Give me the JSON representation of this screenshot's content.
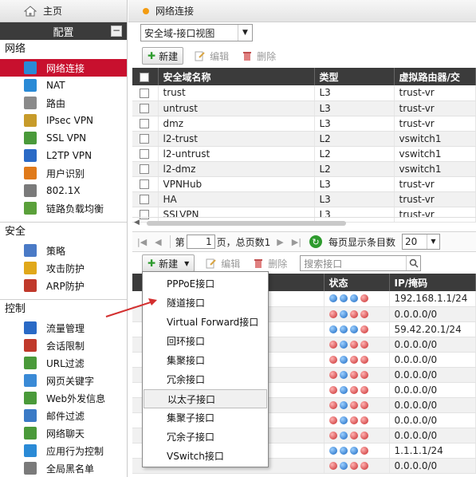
{
  "sidebar": {
    "home": "主页",
    "config": "配置",
    "collapse": "−",
    "groups": [
      {
        "title": "网络",
        "items": [
          {
            "label": "网络连接",
            "active": true,
            "icon": "globe-icon",
            "color": "#2a8ad6"
          },
          {
            "label": "NAT",
            "icon": "globe-icon",
            "color": "#2a8ad6"
          },
          {
            "label": "路由",
            "icon": "router-icon",
            "color": "#8a8a8a"
          },
          {
            "label": "IPsec VPN",
            "icon": "vpn-icon",
            "color": "#c79b2a"
          },
          {
            "label": "SSL VPN",
            "icon": "vpn-icon",
            "color": "#4a9a3a"
          },
          {
            "label": "L2TP VPN",
            "icon": "vpn-icon",
            "color": "#2a6ac6"
          },
          {
            "label": "用户识别",
            "icon": "user-icon",
            "color": "#e07a1a"
          },
          {
            "label": "802.1X",
            "icon": "users-icon",
            "color": "#7a7a7a"
          },
          {
            "label": "链路负载均衡",
            "icon": "balance-icon",
            "color": "#5aa03a"
          }
        ]
      },
      {
        "title": "安全",
        "items": [
          {
            "label": "策略",
            "icon": "policy-icon",
            "color": "#4a7ac6"
          },
          {
            "label": "攻击防护",
            "icon": "shield-icon",
            "color": "#e0a81a"
          },
          {
            "label": "ARP防护",
            "icon": "arp-icon",
            "color": "#c0392b"
          }
        ]
      },
      {
        "title": "控制",
        "items": [
          {
            "label": "流量管理",
            "icon": "traffic-icon",
            "color": "#2a6ac6"
          },
          {
            "label": "会话限制",
            "icon": "session-icon",
            "color": "#c0392b"
          },
          {
            "label": "URL过滤",
            "icon": "url-filter-icon",
            "color": "#4a9a3a"
          },
          {
            "label": "网页关键字",
            "icon": "keyword-icon",
            "color": "#3a8ad6"
          },
          {
            "label": "Web外发信息",
            "icon": "web-out-icon",
            "color": "#4a9a3a"
          },
          {
            "label": "邮件过滤",
            "icon": "mail-filter-icon",
            "color": "#3a7ac6"
          },
          {
            "label": "网络聊天",
            "icon": "chat-icon",
            "color": "#4a9a3a"
          },
          {
            "label": "应用行为控制",
            "icon": "app-control-icon",
            "color": "#2a8ad6"
          },
          {
            "label": "全局黑名单",
            "icon": "blacklist-icon",
            "color": "#7a7a7a"
          }
        ]
      }
    ]
  },
  "panel": {
    "title": "网络连接",
    "view_select": "安全域-接口视图",
    "toolbar1": {
      "new": "新建",
      "edit": "编辑",
      "delete": "删除"
    },
    "zones_table": {
      "headers": [
        "安全域名称",
        "类型",
        "虚拟路由器/交"
      ],
      "rows": [
        [
          "trust",
          "L3",
          "trust-vr"
        ],
        [
          "untrust",
          "L3",
          "trust-vr"
        ],
        [
          "dmz",
          "L3",
          "trust-vr"
        ],
        [
          "l2-trust",
          "L2",
          "vswitch1"
        ],
        [
          "l2-untrust",
          "L2",
          "vswitch1"
        ],
        [
          "l2-dmz",
          "L2",
          "vswitch1"
        ],
        [
          "VPNHub",
          "L3",
          "trust-vr"
        ],
        [
          "HA",
          "L3",
          "trust-vr"
        ],
        [
          "SSLVPN",
          "L3",
          "trust-vr"
        ]
      ]
    },
    "pager": {
      "page_label": "第",
      "page": "1",
      "total": "页，总页数1",
      "per_page_label": "每页显示条目数",
      "per_page": "20"
    },
    "toolbar2": {
      "new": "新建",
      "edit": "编辑",
      "delete": "删除",
      "search_placeholder": "搜索接口"
    },
    "iface_table": {
      "headers": [
        "状态",
        "IP/掩码"
      ],
      "rows": [
        {
          "ip": "192.168.1.1/24",
          "status": [
            "blue",
            "blue",
            "blue",
            "red"
          ]
        },
        {
          "ip": "0.0.0.0/0",
          "status": [
            "red",
            "blue",
            "red",
            "red"
          ]
        },
        {
          "ip": "59.42.20.1/24",
          "status": [
            "blue",
            "blue",
            "blue",
            "red"
          ]
        },
        {
          "ip": "0.0.0.0/0",
          "status": [
            "red",
            "blue",
            "red",
            "red"
          ]
        },
        {
          "ip": "0.0.0.0/0",
          "status": [
            "red",
            "blue",
            "red",
            "red"
          ]
        },
        {
          "ip": "0.0.0.0/0",
          "status": [
            "red",
            "blue",
            "red",
            "red"
          ]
        },
        {
          "ip": "0.0.0.0/0",
          "status": [
            "red",
            "blue",
            "red",
            "red"
          ]
        },
        {
          "ip": "0.0.0.0/0",
          "status": [
            "red",
            "blue",
            "red",
            "red"
          ]
        },
        {
          "ip": "0.0.0.0/0",
          "status": [
            "red",
            "blue",
            "red",
            "red"
          ]
        },
        {
          "ip": "0.0.0.0/0",
          "status": [
            "red",
            "blue",
            "red",
            "red"
          ]
        },
        {
          "ip": "1.1.1.1/24",
          "status": [
            "blue",
            "blue",
            "blue",
            "red"
          ]
        },
        {
          "ip": "0.0.0.0/0",
          "status": [
            "red",
            "blue",
            "red",
            "red"
          ]
        }
      ]
    },
    "new_menu": [
      "PPPoE接口",
      "隧道接口",
      "Virtual Forward接口",
      "回环接口",
      "集聚接口",
      "冗余接口",
      "以太子接口",
      "集聚子接口",
      "冗余子接口",
      "VSwitch接口"
    ],
    "highlighted_menu_index": 6
  },
  "colors": {
    "accent": "#c8102e",
    "header_dark": "#3b3b3b",
    "status_blue": "#1565c0",
    "status_red": "#c62828",
    "annotation_arrow": "#d32f2f"
  }
}
